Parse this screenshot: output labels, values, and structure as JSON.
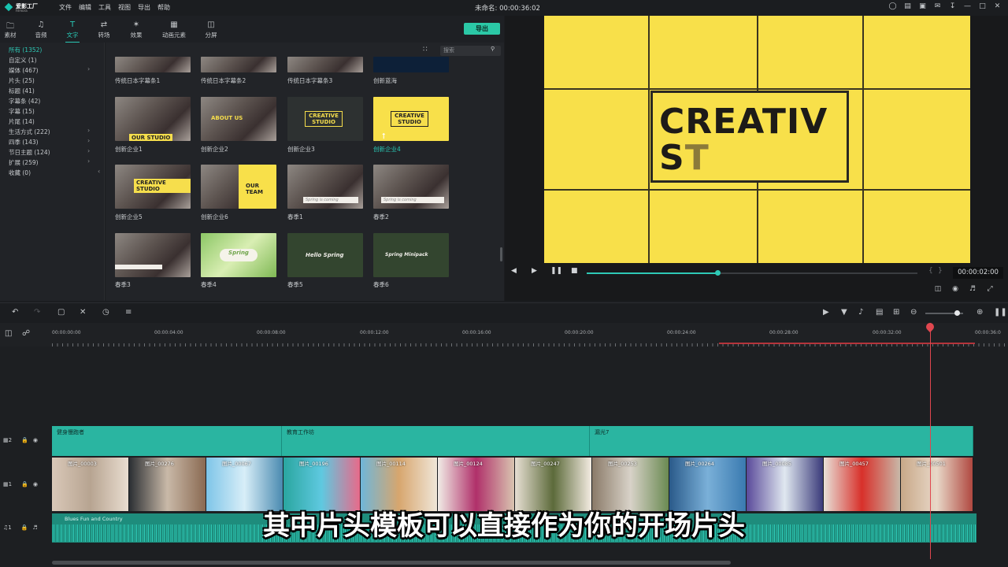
{
  "app": {
    "logo_text": "爱影工厂",
    "logo_sub": "Filmora",
    "window_title": "未命名: 00:00:36:02"
  },
  "menu": [
    "文件",
    "编辑",
    "工具",
    "视图",
    "导出",
    "帮助"
  ],
  "tabs": [
    {
      "label": "素材",
      "icon": "folder-icon"
    },
    {
      "label": "音频",
      "icon": "music-note-icon"
    },
    {
      "label": "文字",
      "icon": "text-icon",
      "active": true
    },
    {
      "label": "转场",
      "icon": "transition-icon"
    },
    {
      "label": "效果",
      "icon": "effects-icon"
    },
    {
      "label": "动画元素",
      "icon": "image-icon"
    },
    {
      "label": "分屏",
      "icon": "split-screen-icon"
    }
  ],
  "export_label": "导出",
  "search": {
    "placeholder": "搜索"
  },
  "categories": [
    {
      "label": "所有 (1352)",
      "active": true
    },
    {
      "label": "自定义 (1)"
    },
    {
      "label": "媒体 (467)",
      "expand": true
    },
    {
      "label": "片头 (25)"
    },
    {
      "label": "标题 (41)"
    },
    {
      "label": "字幕条 (42)"
    },
    {
      "label": "字幕 (15)"
    },
    {
      "label": "片尾 (14)"
    },
    {
      "label": "生活方式 (222)",
      "expand": true
    },
    {
      "label": "四季 (143)",
      "expand": true
    },
    {
      "label": "节日主题 (124)",
      "expand": true
    },
    {
      "label": "扩展 (259)",
      "expand": true
    },
    {
      "label": "收藏 (0)"
    }
  ],
  "thumbnails": [
    {
      "label": "传统日本字幕条1"
    },
    {
      "label": "传统日本字幕条2"
    },
    {
      "label": "传统日本字幕条3"
    },
    {
      "label": "创新蓝海"
    },
    {
      "label": "创新企业1",
      "caption": "OUR STUDIO"
    },
    {
      "label": "创新企业2",
      "caption": "ABOUT US"
    },
    {
      "label": "创新企业3",
      "caption": "CREATIVE STUDIO"
    },
    {
      "label": "创新企业4",
      "caption": "CREATIVE STUDIO",
      "selected": true
    },
    {
      "label": "创新企业5",
      "caption": "CREATIVE STUDIO"
    },
    {
      "label": "创新企业6",
      "caption": "OUR TEAM"
    },
    {
      "label": "春季1",
      "caption": "Spring is coming"
    },
    {
      "label": "春季2",
      "caption": "Spring is coming"
    },
    {
      "label": "春季3"
    },
    {
      "label": "春季4",
      "caption": "Spring"
    },
    {
      "label": "春季5",
      "caption": "Hello Spring"
    },
    {
      "label": "春季6",
      "caption": "Spring Minipack"
    }
  ],
  "preview": {
    "line1": "CREATIV",
    "line2a": "S",
    "line2b": "T",
    "timecode": "00:00:02:00"
  },
  "ruler": [
    "00:00:00:00",
    "00:00:04:00",
    "00:00:08:00",
    "00:00:12:00",
    "00:00:16:00",
    "00:00:20:00",
    "00:00:24:00",
    "00:00:28:00",
    "00:00:32:00",
    "00:00:36:0"
  ],
  "tracks": {
    "title_track": "2",
    "video_track": "1",
    "audio_track": "1"
  },
  "title_clips": [
    {
      "label": "健身慢跑者"
    },
    {
      "label": "教育工作坊"
    },
    {
      "label": "漏光7"
    }
  ],
  "video_clips": [
    {
      "label": "图片_00003"
    },
    {
      "label": "图片_00276"
    },
    {
      "label": "图片_00067"
    },
    {
      "label": "图片_00196"
    },
    {
      "label": "图片_00114"
    },
    {
      "label": "图片_00124"
    },
    {
      "label": "图片_00247"
    },
    {
      "label": "图片_00253"
    },
    {
      "label": "图片_00264"
    },
    {
      "label": "图片_00085"
    },
    {
      "label": "图片_00457"
    },
    {
      "label": "图片_00501"
    }
  ],
  "audio_clip": {
    "label": "Blues Fun and Country"
  },
  "subtitle": "其中片头模板可以直接作为你的开场片头"
}
